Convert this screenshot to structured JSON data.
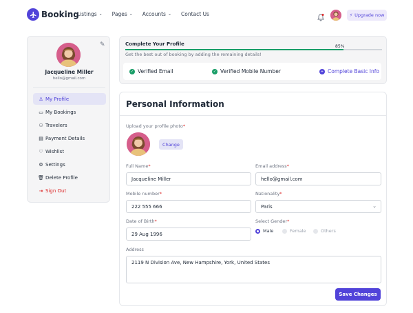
{
  "nav": {
    "brand": "Booking",
    "menu": [
      {
        "label": "Listings",
        "has_dropdown": true
      },
      {
        "label": "Pages",
        "has_dropdown": true
      },
      {
        "label": "Accounts",
        "has_dropdown": true
      },
      {
        "label": "Contact Us",
        "has_dropdown": false
      }
    ],
    "upgrade_label": "Upgrade now",
    "brand_color": "#5143d9"
  },
  "sidebar": {
    "name": "Jacqueline Miller",
    "email": "hello@gmail.com",
    "items": [
      {
        "label": "My Profile",
        "icon": "person-icon",
        "active": true
      },
      {
        "label": "My Bookings",
        "icon": "ticket-icon",
        "active": false
      },
      {
        "label": "Travelers",
        "icon": "people-icon",
        "active": false
      },
      {
        "label": "Payment Details",
        "icon": "wallet-icon",
        "active": false
      },
      {
        "label": "Wishlist",
        "icon": "heart-icon",
        "active": false
      },
      {
        "label": "Settings",
        "icon": "gear-icon",
        "active": false
      },
      {
        "label": "Delete Profile",
        "icon": "trash-icon",
        "active": false
      },
      {
        "label": "Sign Out",
        "icon": "sign-out-icon",
        "active": false,
        "danger": true
      }
    ]
  },
  "completion": {
    "title": "Complete Your Profile",
    "percent_label": "85%",
    "percent": 85,
    "subtitle": "Get the best out of booking by adding the remaining details!",
    "checks": [
      {
        "label": "Verified Email",
        "done": true
      },
      {
        "label": "Verified Mobile Number",
        "done": true
      },
      {
        "label": "Complete Basic Info",
        "done": false
      }
    ]
  },
  "form": {
    "title": "Personal Information",
    "photo_label": "Upload your profile photo",
    "change_label": "Change",
    "full_name": {
      "label": "Full Name",
      "value": "Jacqueline Miller"
    },
    "email": {
      "label": "Email address",
      "value": "hello@gmail.com"
    },
    "mobile": {
      "label": "Mobile number",
      "value": "222 555 666"
    },
    "nationality": {
      "label": "Nationality",
      "value": "Paris"
    },
    "dob": {
      "label": "Date of Birth",
      "value": "29 Aug 1996"
    },
    "gender": {
      "label": "Select Gender",
      "options": [
        "Male",
        "Female",
        "Others"
      ],
      "selected": "Male"
    },
    "address": {
      "label": "Address",
      "value": "2119 N Division Ave, New Hampshire, York, United States"
    },
    "save_label": "Save Changes"
  }
}
